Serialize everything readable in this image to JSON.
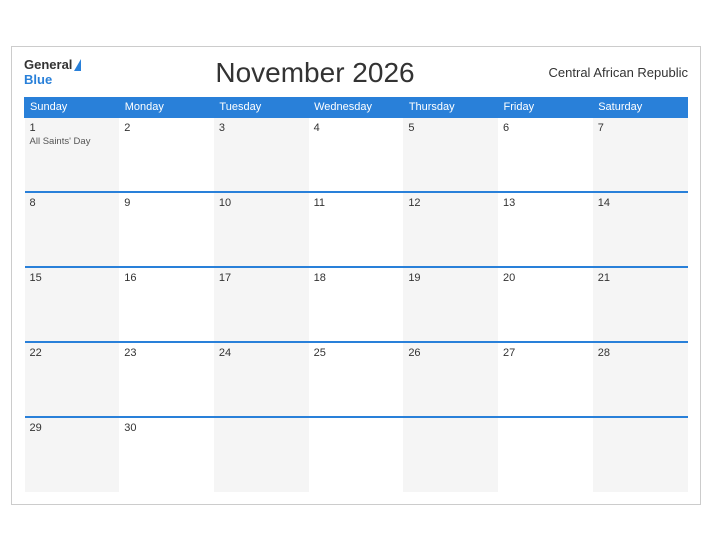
{
  "header": {
    "title": "November 2026",
    "country": "Central African Republic",
    "logo_general": "General",
    "logo_blue": "Blue"
  },
  "weekdays": [
    "Sunday",
    "Monday",
    "Tuesday",
    "Wednesday",
    "Thursday",
    "Friday",
    "Saturday"
  ],
  "weeks": [
    [
      {
        "day": "1",
        "holiday": "All Saints' Day"
      },
      {
        "day": "2",
        "holiday": ""
      },
      {
        "day": "3",
        "holiday": ""
      },
      {
        "day": "4",
        "holiday": ""
      },
      {
        "day": "5",
        "holiday": ""
      },
      {
        "day": "6",
        "holiday": ""
      },
      {
        "day": "7",
        "holiday": ""
      }
    ],
    [
      {
        "day": "8",
        "holiday": ""
      },
      {
        "day": "9",
        "holiday": ""
      },
      {
        "day": "10",
        "holiday": ""
      },
      {
        "day": "11",
        "holiday": ""
      },
      {
        "day": "12",
        "holiday": ""
      },
      {
        "day": "13",
        "holiday": ""
      },
      {
        "day": "14",
        "holiday": ""
      }
    ],
    [
      {
        "day": "15",
        "holiday": ""
      },
      {
        "day": "16",
        "holiday": ""
      },
      {
        "day": "17",
        "holiday": ""
      },
      {
        "day": "18",
        "holiday": ""
      },
      {
        "day": "19",
        "holiday": ""
      },
      {
        "day": "20",
        "holiday": ""
      },
      {
        "day": "21",
        "holiday": ""
      }
    ],
    [
      {
        "day": "22",
        "holiday": ""
      },
      {
        "day": "23",
        "holiday": ""
      },
      {
        "day": "24",
        "holiday": ""
      },
      {
        "day": "25",
        "holiday": ""
      },
      {
        "day": "26",
        "holiday": ""
      },
      {
        "day": "27",
        "holiday": ""
      },
      {
        "day": "28",
        "holiday": ""
      }
    ],
    [
      {
        "day": "29",
        "holiday": ""
      },
      {
        "day": "30",
        "holiday": ""
      },
      {
        "day": "",
        "holiday": ""
      },
      {
        "day": "",
        "holiday": ""
      },
      {
        "day": "",
        "holiday": ""
      },
      {
        "day": "",
        "holiday": ""
      },
      {
        "day": "",
        "holiday": ""
      }
    ]
  ]
}
